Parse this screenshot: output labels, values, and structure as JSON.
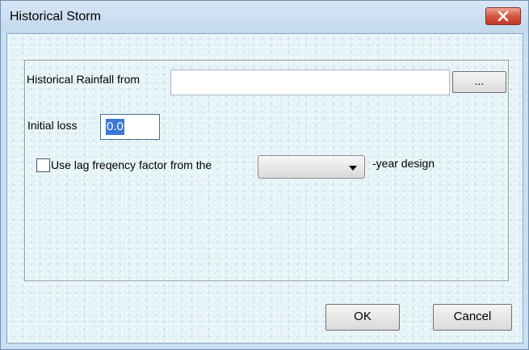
{
  "window": {
    "title": "Historical Storm",
    "close_icon": "close-icon"
  },
  "form": {
    "rainfall_label": "Historical Rainfall from",
    "rainfall_value": "",
    "browse_label": "...",
    "initial_loss_label": "Initial loss",
    "initial_loss_value": "0.0",
    "use_lag_label": "Use lag freqency factor from the",
    "use_lag_checked": false,
    "design_select_value": "",
    "year_design_suffix": "-year design"
  },
  "buttons": {
    "ok_label": "OK",
    "cancel_label": "Cancel"
  },
  "colors": {
    "title_bar": "#c9dff2",
    "close_button": "#c9503b",
    "selection": "#3a78d8"
  }
}
